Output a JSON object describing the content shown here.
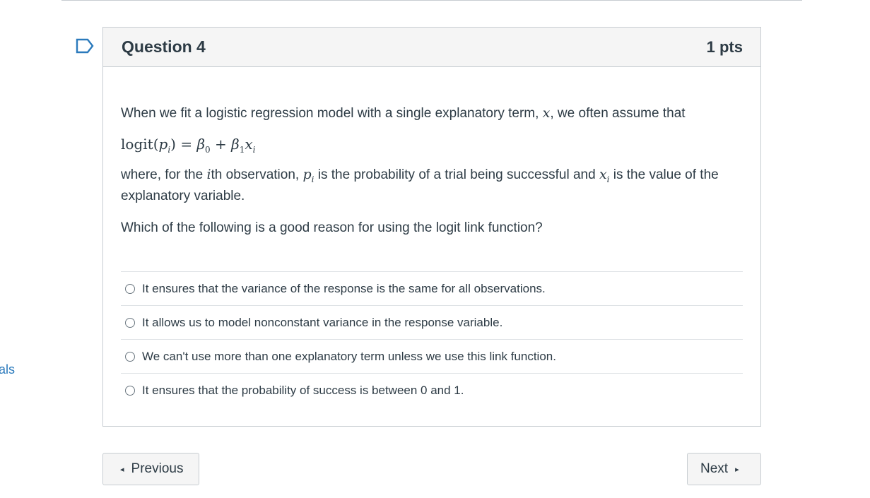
{
  "side_nav": {
    "partial_link": "als"
  },
  "question": {
    "title": "Question 4",
    "points": "1 pts",
    "flag_icon": "bookmark-flag-icon",
    "intro": "When we fit a logistic regression model with a single explanatory term, ",
    "intro_var": "x",
    "intro_end": ", we often assume that",
    "equation": {
      "fn": "logit",
      "open": "(",
      "p": "p",
      "sub_i": "i",
      "close": ")",
      "equals": " = ",
      "beta": "β",
      "sub_0": "0",
      "plus": " + ",
      "sub_1": "1",
      "x": "x"
    },
    "where_a": "where, for the ",
    "where_ith": "i",
    "where_th": "th",
    "where_b": " observation, ",
    "where_c": " is the probability of a trial being successful and ",
    "where_d": " is the value of the explanatory variable.",
    "prompt": "Which of the following is a good reason for using the logit link function?",
    "answers": [
      "It ensures that the variance of the response is the same for all observations.",
      "It allows us to model nonconstant variance in the response variable.",
      "We can't use more than one explanatory term unless we use this link function.",
      "It ensures that the probability of success is between 0 and 1."
    ]
  },
  "nav": {
    "previous_label": "Previous",
    "next_label": "Next",
    "prev_icon": "◂",
    "next_icon": "▸"
  },
  "colors": {
    "link": "#2b7abc",
    "text": "#2d3b45",
    "header_bg": "#f5f5f5",
    "border": "#c7cdd1"
  }
}
